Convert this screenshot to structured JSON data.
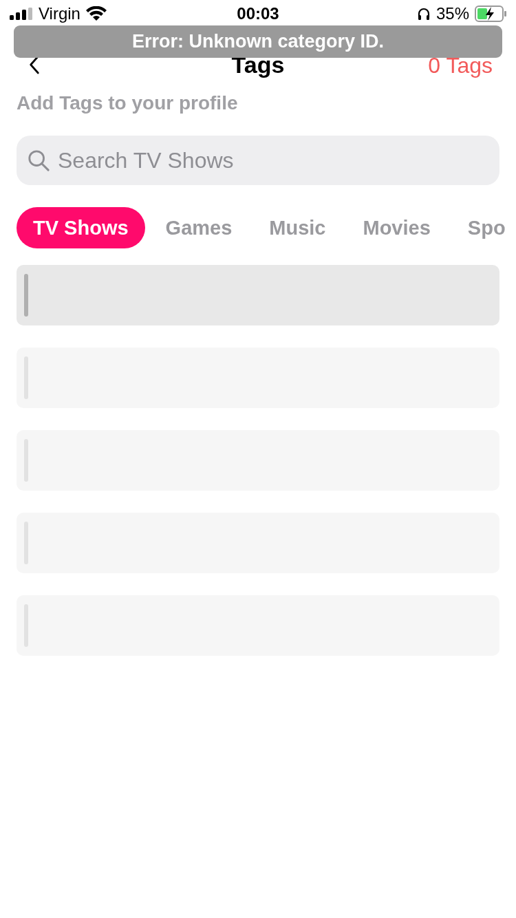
{
  "status_bar": {
    "carrier": "Virgin",
    "time": "00:03",
    "battery_percent": "35%"
  },
  "toast": {
    "message": "Error: Unknown category ID."
  },
  "nav_bar": {
    "title": "Tags",
    "count": "0 Tags"
  },
  "subtitle": "Add Tags to your profile",
  "search": {
    "placeholder": "Search TV Shows"
  },
  "tabs": [
    {
      "label": "TV Shows",
      "selected": true
    },
    {
      "label": "Games",
      "selected": false
    },
    {
      "label": "Music",
      "selected": false
    },
    {
      "label": "Movies",
      "selected": false
    },
    {
      "label": "Spo",
      "selected": false
    }
  ],
  "skeleton_rows": [
    {
      "highlighted": true
    },
    {
      "highlighted": false
    },
    {
      "highlighted": false
    },
    {
      "highlighted": false
    },
    {
      "highlighted": false
    }
  ]
}
